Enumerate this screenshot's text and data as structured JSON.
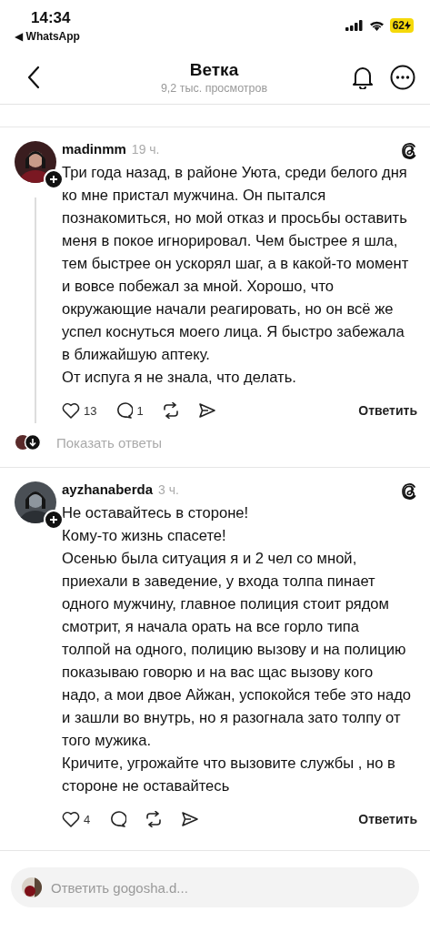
{
  "status_bar": {
    "time": "14:34",
    "back_app": "◀ WhatsApp",
    "battery": "62"
  },
  "header": {
    "title": "Ветка",
    "subtitle": "9,2 тыс. просмотров"
  },
  "posts": [
    {
      "username": "madinmm",
      "time": "19 ч.",
      "paragraphs": [
        "Три года назад, в районе Уюта, среди белого дня ко мне пристал мужчина. Он пытался познакомиться, но мой отказ и просьбы оставить меня в покое игнорировал. Чем быстрее я шла, тем быстрее он ускорял шаг, а в какой-то момент и вовсе побежал за мной. Хорошо, что окружающие начали реагировать, но он всё же успел коснуться моего лица. Я быстро забежала в ближайшую аптеку.",
        "От испуга я не знала, что делать."
      ],
      "likes": "13",
      "comments": "1",
      "reply_label": "Ответить",
      "thread_line": true,
      "show_replies": "Показать ответы"
    },
    {
      "username": "ayzhanaberda",
      "time": "3 ч.",
      "paragraphs": [
        "Не оставайтесь в стороне!",
        "Кому-то жизнь спасете!",
        "Осенью была ситуация я и 2 чел со мной, приехали в заведение, у входа толпа пинает одного мужчину, главное полиция стоит рядом смотрит, я начала орать на все горло типа толпой на одного, полицию вызову и на полицию показываю говорю и на вас щас вызову кого надо, а мои двое Айжан, успокойся тебе это надо и зашли во внутрь, но я разогнала зато толпу от того мужика.",
        "Кричите, угрожайте что вызовите службы , но в стороне не оставайтесь"
      ],
      "likes": "4",
      "reply_label": "Ответить",
      "thread_line": false
    }
  ],
  "reply_field": {
    "placeholder": "Ответить gogosha.d..."
  }
}
